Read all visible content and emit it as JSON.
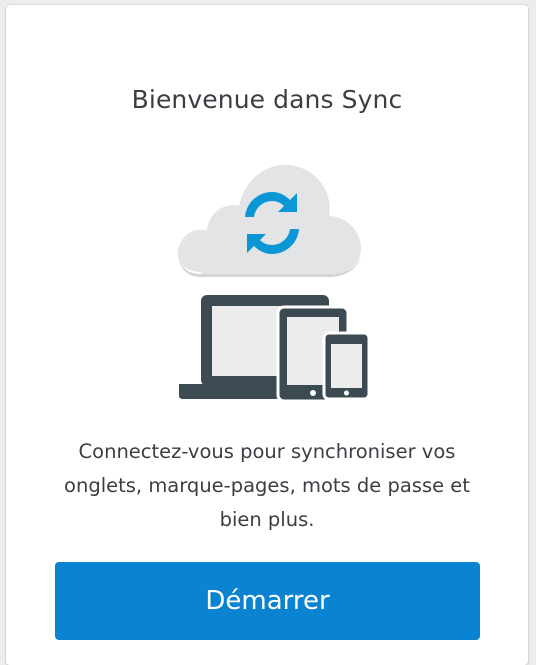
{
  "onboarding": {
    "title": "Bienvenue dans Sync",
    "description": "Connectez-vous pour synchroniser vos onglets, marque-pages, mots de passe et bien plus.",
    "start_button_label": "Démarrer"
  },
  "illustration": {
    "cloud_icon": "cloud-icon",
    "sync_icon": "sync-arrows-icon",
    "devices": [
      "laptop-icon",
      "tablet-icon",
      "phone-icon"
    ]
  },
  "colors": {
    "accent": "#0a84d0",
    "sync_arrows": "#0b97d6",
    "cloud": "#e2e4e6",
    "device_frame": "#3c4a51",
    "screen": "#ececec",
    "text": "#3d3d44"
  }
}
